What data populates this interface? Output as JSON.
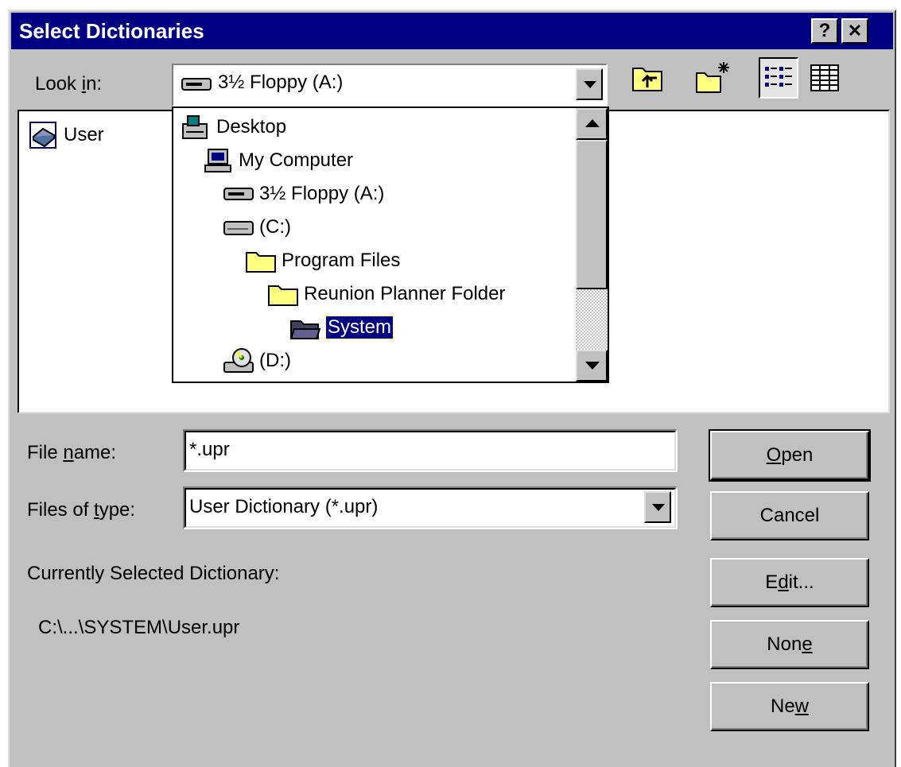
{
  "window": {
    "title": "Select Dictionaries",
    "help_btn": "?",
    "close_btn": "✕"
  },
  "look_in": {
    "label_pre": "Look ",
    "label_key": "i",
    "label_post": "n:",
    "value": "3½ Floppy (A:)"
  },
  "toolbar": {
    "up_folder": "up-one-level",
    "new_folder": "create-new-folder",
    "list_view": "list",
    "details_view": "details"
  },
  "file_list": {
    "items": [
      {
        "name": "User",
        "icon": "dictionary-file-icon"
      }
    ]
  },
  "dropdown": {
    "items": [
      {
        "label": "Desktop",
        "icon": "desktop-icon"
      },
      {
        "label": "My Computer",
        "icon": "my-computer-icon"
      },
      {
        "label": "3½ Floppy (A:)",
        "icon": "floppy-drive-icon"
      },
      {
        "label": "(C:)",
        "icon": "hard-drive-icon"
      },
      {
        "label": "Program Files",
        "icon": "folder-icon"
      },
      {
        "label": "Reunion Planner Folder",
        "icon": "folder-icon"
      },
      {
        "label": "System",
        "icon": "open-folder-icon",
        "selected": true
      },
      {
        "label": "(D:)",
        "icon": "cd-drive-icon"
      }
    ]
  },
  "file_name": {
    "label_pre": "File ",
    "label_key": "n",
    "label_post": "ame:",
    "value": "*.upr"
  },
  "files_of_type": {
    "label_pre": "Files of ",
    "label_key": "t",
    "label_post": "ype:",
    "value": "User Dictionary (*.upr)"
  },
  "current_dictionary": {
    "label": "Currently Selected Dictionary:",
    "path": "C:\\...\\SYSTEM\\User.upr"
  },
  "buttons": {
    "open": {
      "pre": "",
      "key": "O",
      "post": "pen"
    },
    "cancel": {
      "label": "Cancel"
    },
    "edit": {
      "pre": "E",
      "key": "d",
      "post": "it..."
    },
    "none": {
      "pre": "Non",
      "key": "e",
      "post": ""
    },
    "new": {
      "pre": "Ne",
      "key": "w",
      "post": ""
    }
  }
}
